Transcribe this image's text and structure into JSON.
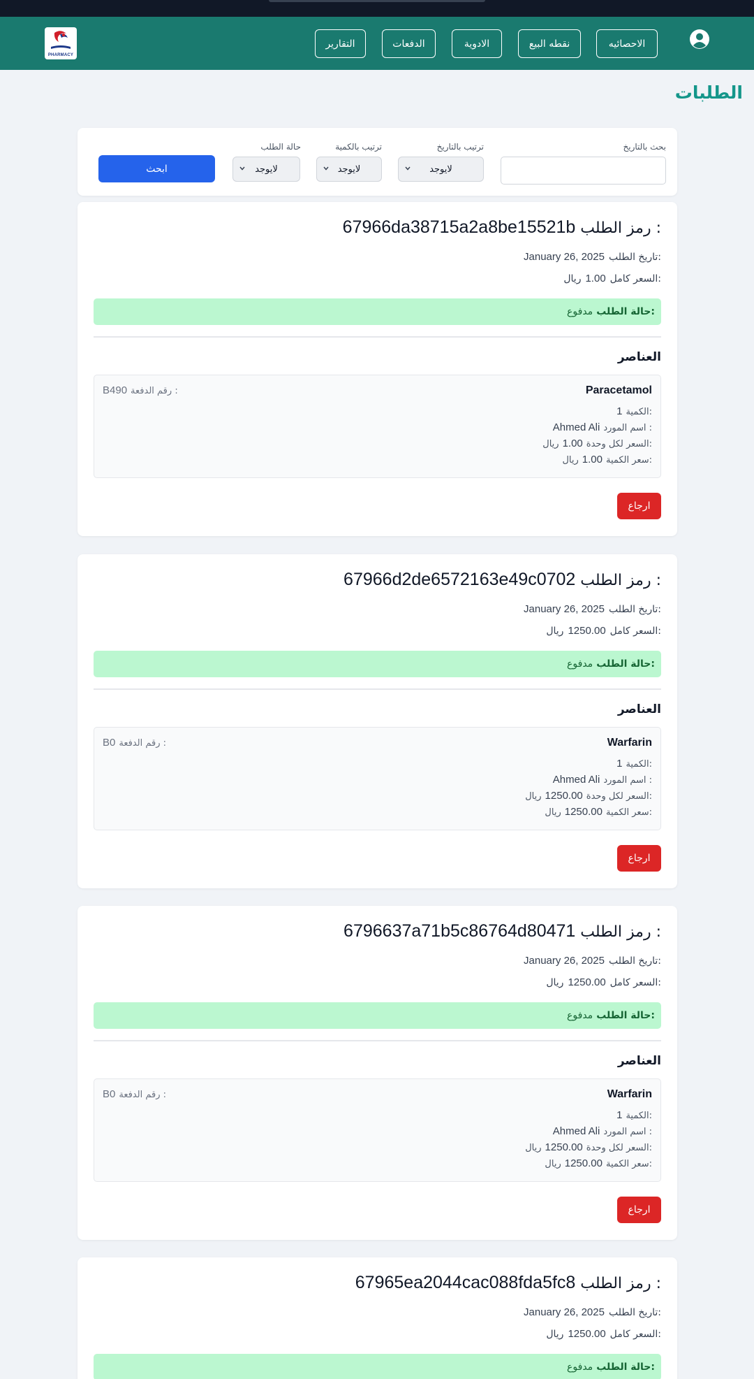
{
  "nav": {
    "logo_text": "PHARMACY",
    "buttons": [
      "الاحصائيه",
      "نقطه البيع",
      "الادوية",
      "الدفعات",
      "التقارير"
    ]
  },
  "page": {
    "title": "الطلبات"
  },
  "filters": {
    "search_date_label": "بحث بالتاريخ",
    "sort_date_label": "ترتيب بالتاريخ",
    "sort_qty_label": "ترتيب بالكمية",
    "status_label": "حالة الطلب",
    "sort_date_value": "لايوجد",
    "sort_qty_value": "لايوجد",
    "status_value": "لايوجد",
    "search_button": "ابحث"
  },
  "labels": {
    "order_code": "رمز الطلب :",
    "order_date": "تاريخ الطلب:",
    "total_price": "السعر كامل:",
    "order_status": "حالة الطلب:",
    "items_heading": "العناصر",
    "quantity": "الكمية:",
    "supplier": "اسم المورد :",
    "unit_price": "السعر لكل وحدة:",
    "qty_price": "سعر الكمية:",
    "batch": "رقم الدفعة :",
    "currency": "ريال",
    "return_button": "ارجاع"
  },
  "orders": [
    {
      "code": "67966da38715a2a8be15521b",
      "date": "January 26, 2025",
      "total": "1.00",
      "status": "مدفوع",
      "item": {
        "name": "Paracetamol",
        "batch": "B490",
        "quantity": "1",
        "supplier": "Ahmed Ali",
        "unit_price": "1.00",
        "qty_price": "1.00"
      }
    },
    {
      "code": "67966d2de6572163e49c0702",
      "date": "January 26, 2025",
      "total": "1250.00",
      "status": "مدفوع",
      "item": {
        "name": "Warfarin",
        "batch": "B0",
        "quantity": "1",
        "supplier": "Ahmed Ali",
        "unit_price": "1250.00",
        "qty_price": "1250.00"
      }
    },
    {
      "code": "6796637a71b5c86764d80471",
      "date": "January 26, 2025",
      "total": "1250.00",
      "status": "مدفوع",
      "item": {
        "name": "Warfarin",
        "batch": "B0",
        "quantity": "1",
        "supplier": "Ahmed Ali",
        "unit_price": "1250.00",
        "qty_price": "1250.00"
      }
    },
    {
      "code": "67965ea2044cac088fda5fc8",
      "date": "January 26, 2025",
      "total": "1250.00",
      "status": "مدفوع"
    }
  ],
  "colors": {
    "navbar": "#1a7a6f",
    "title": "#14968a",
    "status_bg": "#bbf7d0",
    "return_button": "#dc2626",
    "search_button": "#2563eb"
  }
}
